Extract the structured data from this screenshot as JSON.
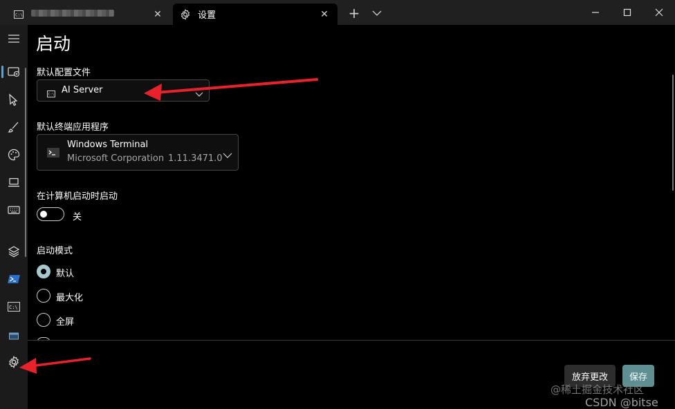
{
  "tabs": [
    {
      "label": "",
      "close": "✕"
    },
    {
      "label": "设置",
      "close": "✕"
    }
  ],
  "window": {
    "new_tab": "+",
    "minimize": "—",
    "maximize": "☐",
    "close": "✕"
  },
  "page": {
    "title": "启动"
  },
  "default_profile": {
    "label": "默认配置文件",
    "value": "AI Server"
  },
  "default_terminal": {
    "label": "默认终端应用程序",
    "name": "Windows Terminal",
    "publisher": "Microsoft Corporation",
    "version": "1.11.3471.0"
  },
  "launch_on_startup": {
    "label": "在计算机启动时启动",
    "state_label": "关",
    "on": false
  },
  "launch_mode": {
    "label": "启动模式",
    "options": [
      "默认",
      "最大化",
      "全屏"
    ],
    "selected": "默认"
  },
  "footer": {
    "discard_label": "放弃更改",
    "save_label": "保存"
  },
  "watermark": {
    "line1": "@稀土掘金技术社区",
    "line2": "CSDN @bitse"
  },
  "colors": {
    "accent": "#5d8f93",
    "arrow": "#e8212a",
    "sidebar_selection": "#5ea3d8"
  }
}
